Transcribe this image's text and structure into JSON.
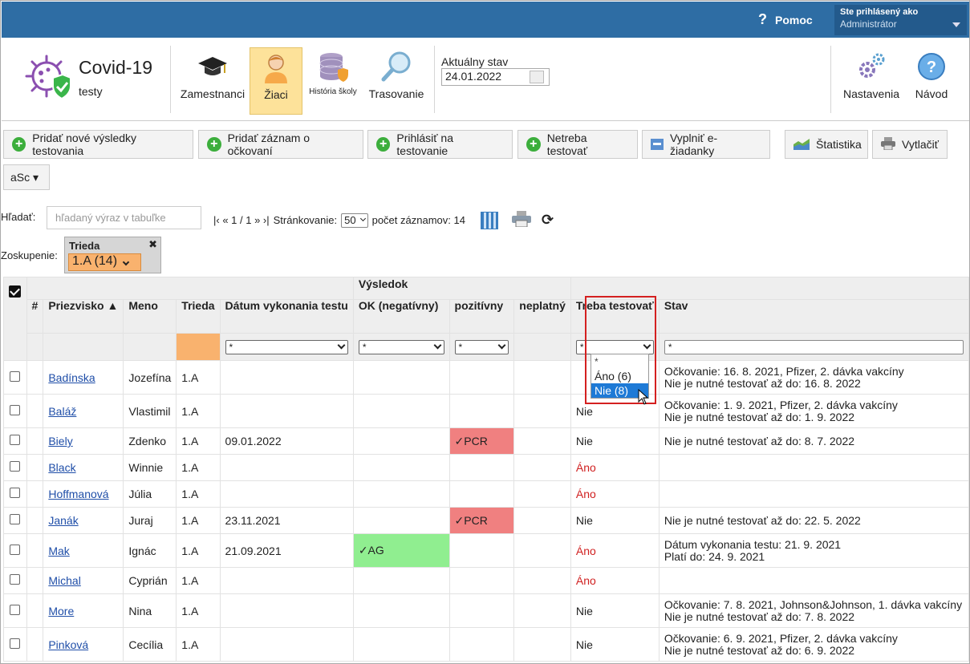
{
  "topbar": {
    "help_label": "Pomoc",
    "user_line1": "Ste prihlásený ako",
    "user_line2": "Administrátor"
  },
  "app": {
    "title": "Covid-19",
    "subtitle": "testy"
  },
  "nav": {
    "employees": "Zamestnanci",
    "students": "Žiaci",
    "school_history": "História školy",
    "tracing": "Trasovanie",
    "settings": "Nastavenia",
    "guide": "Návod"
  },
  "state": {
    "label": "Aktuálny stav",
    "date": "24.01.2022"
  },
  "toolbar": {
    "add_results": "Pridať nové výsledky testovania",
    "add_vaccination": "Pridať záznam o očkovaní",
    "register_test": "Prihlásiť na testovanie",
    "no_need_test": "Netreba testovať",
    "fill_e_request": "Vyplniť e-žiadanky",
    "statistics": "Štatistika",
    "print": "Vytlačiť",
    "asc": "aSc ▾"
  },
  "search": {
    "label": "Hľadať:",
    "placeholder": "hľadaný výraz v tabuľke",
    "pager": "|‹ « 1 / 1 » ›|",
    "paging_label": "Stránkovanie:",
    "page_size": "50",
    "count_label": "počet záznamov: 14"
  },
  "grouping": {
    "label": "Zoskupenie:",
    "field": "Trieda",
    "value": "1.A (14)"
  },
  "table": {
    "group_header": "Výsledok",
    "columns": {
      "num": "#",
      "surname": "Priezvisko",
      "name": "Meno",
      "class": "Trieda",
      "test_date": "Dátum vykonania testu",
      "ok": "OK (negatívny)",
      "positive": "pozitívny",
      "invalid": "neplatný",
      "need_test": "Treba testovať",
      "status": "Stav"
    },
    "filter_any": "*",
    "rows": [
      {
        "surname": "Badínska",
        "name": "Jozefína",
        "class": "1.A",
        "date": "",
        "ok": "",
        "pos": "",
        "need": "",
        "status1": "Očkovanie: 16. 8. 2021, Pfizer, 2. dávka vakcíny",
        "status2": "Nie je nutné testovať až do: 16. 8. 2022"
      },
      {
        "surname": "Baláž",
        "name": "Vlastimil",
        "class": "1.A",
        "date": "",
        "ok": "",
        "pos": "",
        "need": "Nie",
        "status1": "Očkovanie: 1. 9. 2021, Pfizer, 2. dávka vakcíny",
        "status2": "Nie je nutné testovať až do: 1. 9. 2022"
      },
      {
        "surname": "Biely",
        "name": "Zdenko",
        "class": "1.A",
        "date": "09.01.2022",
        "ok": "",
        "pos": "✓PCR",
        "need": "Nie",
        "status1": "Nie je nutné testovať až do: 8. 7. 2022",
        "status2": ""
      },
      {
        "surname": "Black",
        "name": "Winnie",
        "class": "1.A",
        "date": "",
        "ok": "",
        "pos": "",
        "need": "Áno",
        "status1": "",
        "status2": ""
      },
      {
        "surname": "Hoffmanová",
        "name": "Júlia",
        "class": "1.A",
        "date": "",
        "ok": "",
        "pos": "",
        "need": "Áno",
        "status1": "",
        "status2": ""
      },
      {
        "surname": "Janák",
        "name": "Juraj",
        "class": "1.A",
        "date": "23.11.2021",
        "ok": "",
        "pos": "✓PCR",
        "need": "Nie",
        "status1": "Nie je nutné testovať až do: 22. 5. 2022",
        "status2": ""
      },
      {
        "surname": "Mak",
        "name": "Ignác",
        "class": "1.A",
        "date": "21.09.2021",
        "ok": "✓AG",
        "pos": "",
        "need": "Áno",
        "status1": "Dátum vykonania testu: 21. 9. 2021",
        "status2": "Platí do: 24. 9. 2021"
      },
      {
        "surname": "Michal",
        "name": "Cyprián",
        "class": "1.A",
        "date": "",
        "ok": "",
        "pos": "",
        "need": "Áno",
        "status1": "",
        "status2": ""
      },
      {
        "surname": "More",
        "name": "Nina",
        "class": "1.A",
        "date": "",
        "ok": "",
        "pos": "",
        "need": "Nie",
        "status1": "Očkovanie: 7. 8. 2021, Johnson&Johnson, 1. dávka vakcíny",
        "status2": "Nie je nutné testovať až do: 7. 8. 2022"
      },
      {
        "surname": "Pinková",
        "name": "Cecília",
        "class": "1.A",
        "date": "",
        "ok": "",
        "pos": "",
        "need": "Nie",
        "status1": "Očkovanie: 6. 9. 2021, Pfizer, 2. dávka vakcíny",
        "status2": "Nie je nutné testovať až do: 6. 9. 2022"
      }
    ]
  },
  "dropdown": {
    "options": [
      "*",
      "Áno (6)",
      "Nie (8)"
    ],
    "selected_index": 2
  },
  "colors": {
    "topbar": "#2e6da4",
    "active_nav": "#fde29a",
    "positive": "#f08080",
    "negative": "#90ee90",
    "yes_text": "#d02020",
    "highlight_border": "#d42020"
  }
}
